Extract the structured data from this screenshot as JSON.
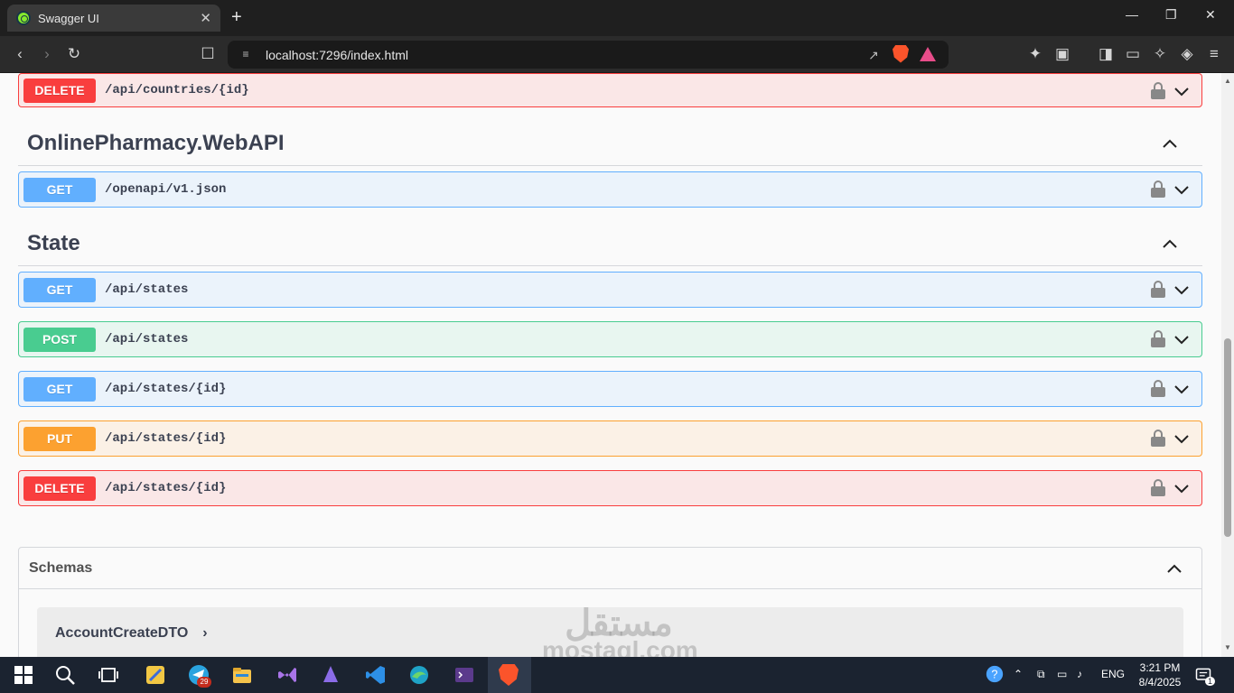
{
  "browser": {
    "tab_title": "Swagger UI",
    "tab_close": "✕",
    "new_tab": "+",
    "url": "localhost:7296/index.html"
  },
  "sections": [
    {
      "kind": "op",
      "method": "DELETE",
      "path": "/api/countries/{id}",
      "top": 0
    },
    {
      "kind": "tag",
      "title": "OnlinePharmacy.WebAPI"
    },
    {
      "kind": "op",
      "method": "GET",
      "path": "/openapi/v1.json"
    },
    {
      "kind": "tag",
      "title": "State"
    },
    {
      "kind": "op",
      "method": "GET",
      "path": "/api/states"
    },
    {
      "kind": "op",
      "method": "POST",
      "path": "/api/states"
    },
    {
      "kind": "op",
      "method": "GET",
      "path": "/api/states/{id}"
    },
    {
      "kind": "op",
      "method": "PUT",
      "path": "/api/states/{id}"
    },
    {
      "kind": "op",
      "method": "DELETE",
      "path": "/api/states/{id}"
    }
  ],
  "ops": {
    "delete_countries": {
      "method": "DELETE",
      "path": "/api/countries/{id}"
    },
    "get_openapi": {
      "method": "GET",
      "path": "/openapi/v1.json"
    },
    "get_states": {
      "method": "GET",
      "path": "/api/states"
    },
    "post_states": {
      "method": "POST",
      "path": "/api/states"
    },
    "get_state": {
      "method": "GET",
      "path": "/api/states/{id}"
    },
    "put_state": {
      "method": "PUT",
      "path": "/api/states/{id}"
    },
    "delete_state": {
      "method": "DELETE",
      "path": "/api/states/{id}"
    }
  },
  "tags": {
    "webapi": "OnlinePharmacy.WebAPI",
    "state": "State"
  },
  "schemas": {
    "title": "Schemas",
    "first_model": "AccountCreateDTO",
    "first_model_arrow": "›"
  },
  "watermark": {
    "arabic": "مستقل",
    "latin": "mostaql.com"
  },
  "taskbar": {
    "telegram_badge": "29",
    "language": "ENG",
    "time": "3:21 PM",
    "date": "8/4/2025",
    "notifications": "1"
  },
  "colors": {
    "get": "#61affe",
    "post": "#49cc90",
    "put": "#fca130",
    "delete": "#f93e3e"
  }
}
